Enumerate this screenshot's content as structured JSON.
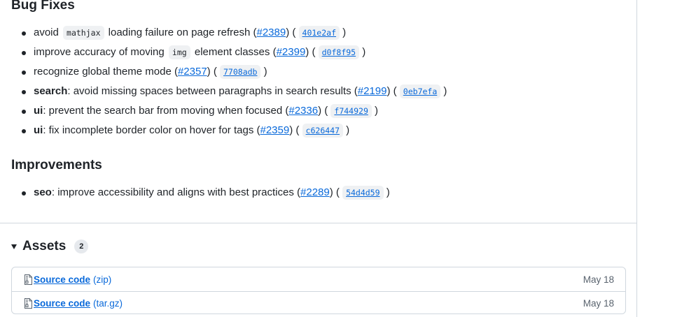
{
  "bug_fixes": {
    "title": "Bug Fixes",
    "items": [
      {
        "pre": "avoid ",
        "code": "mathjax",
        "post": " loading failure on page refresh (",
        "pr": "#2389",
        "mid": ") ( ",
        "sha": "401e2af",
        "end": " )"
      },
      {
        "pre": "improve accuracy of moving ",
        "code": "img",
        "post": " element classes (",
        "pr": "#2399",
        "mid": ") ( ",
        "sha": "d0f8f95",
        "end": " )"
      },
      {
        "text": "recognize global theme mode (",
        "pr": "#2357",
        "mid": ") ( ",
        "sha": "7708adb",
        "end": " )"
      },
      {
        "kw": "search",
        "text": ": avoid missing spaces between paragraphs in search results (",
        "pr": "#2199",
        "mid": ") ( ",
        "sha": "0eb7efa",
        "end": " )"
      },
      {
        "kw": "ui",
        "text": ": prevent the search bar from moving when focused (",
        "pr": "#2336",
        "mid": ") ( ",
        "sha": "f744929",
        "end": " )"
      },
      {
        "kw": "ui",
        "text": ": fix incomplete border color on hover for tags (",
        "pr": "#2359",
        "mid": ") ( ",
        "sha": "c626447",
        "end": " )"
      }
    ]
  },
  "improvements": {
    "title": "Improvements",
    "items": [
      {
        "kw": "seo",
        "text": ": improve accessibility and aligns with best practices (",
        "pr": "#2289",
        "mid": ") ( ",
        "sha": "54d4d59",
        "end": " )"
      }
    ]
  },
  "assets": {
    "title": "Assets",
    "count": "2",
    "rows": [
      {
        "name": "Source code",
        "ext": "(zip)",
        "date": "May 18",
        "icon": "file-zip-icon"
      },
      {
        "name": "Source code",
        "ext": "(tar.gz)",
        "date": "May 18",
        "icon": "file-zip-icon"
      }
    ]
  },
  "colors": {
    "link": "#0969da",
    "text": "#1f2328",
    "border": "#d0d7de",
    "code_bg": "#eff1f3"
  }
}
